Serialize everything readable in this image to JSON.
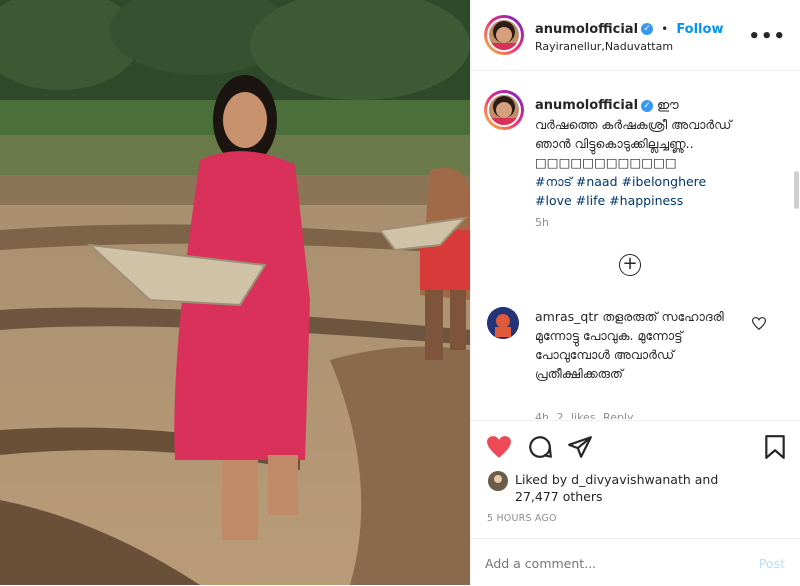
{
  "post": {
    "username": "anumolofficial",
    "verified_glyph": "✓",
    "separator": "•",
    "follow_label": "Follow",
    "location": "Rayiranellur,Naduvattam",
    "more_icon": "more-horizontal-icon"
  },
  "caption": {
    "username": "anumolofficial",
    "text": "ഈ വർഷത്തെ കർഷകശ്രീ അവാർഡ് ഞാൻ വിട്ടുകൊടുക്കില്ലച്ചണ്ണു.. □□□□□□□□□□□□",
    "hashtags": [
      "#നാട്",
      "#naad",
      "#ibelonghere",
      "#love",
      "#life",
      "#happiness"
    ],
    "time": "5h"
  },
  "comment": {
    "username": "amras_qtr",
    "text": "തളരരുത് സഹോദരി മുന്നോട്ടു പോവുക. മുന്നോട്ട് പോവുമ്പോൾ അവാർഡ് പ്രതീക്ഷിക്കരുത്",
    "meta": "4h   2 likes   Reply"
  },
  "actions": {
    "like_icon": "heart-filled-icon",
    "comment_icon": "comment-icon",
    "share_icon": "share-icon",
    "save_icon": "bookmark-icon",
    "liked_by_prefix": "Liked by ",
    "liked_by_user": "d_divyavishwanath",
    "liked_by_and": " and",
    "others_count": "27,477 others",
    "posted_time": "5 HOURS AGO"
  },
  "add_comment": {
    "placeholder": "Add a comment...",
    "post_label": "Post"
  },
  "colors": {
    "accent": "#0095f6",
    "like": "#ed4956",
    "border": "#efefef"
  }
}
